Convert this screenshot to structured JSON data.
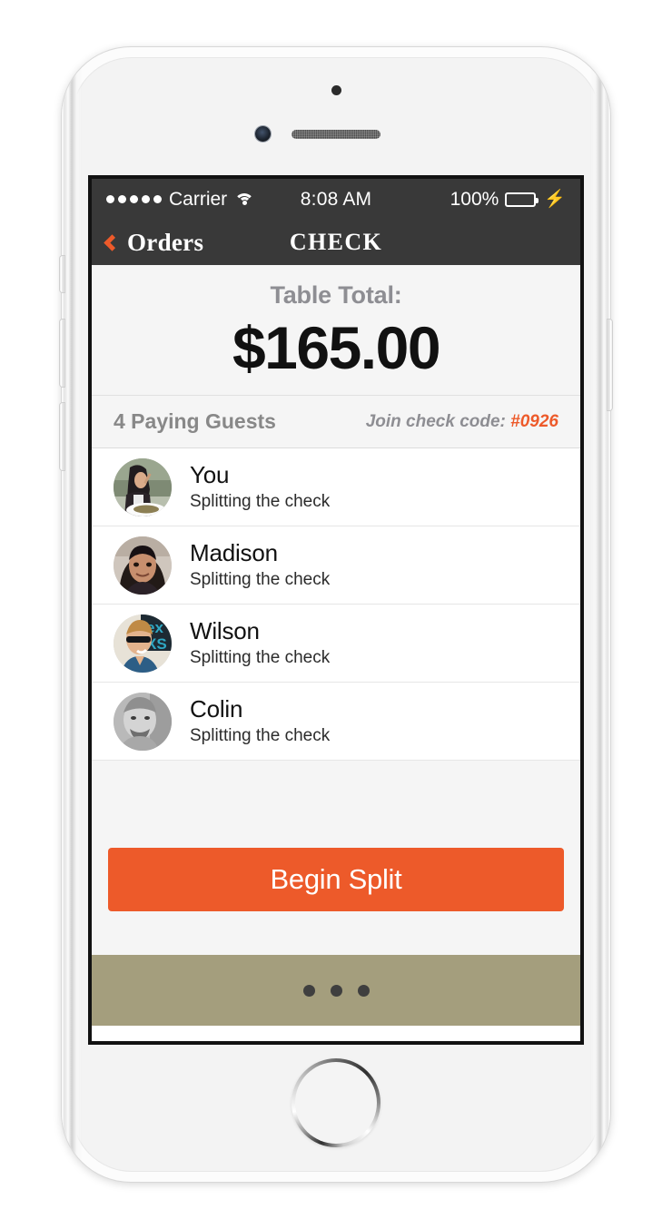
{
  "status_bar": {
    "signal_dots": 5,
    "carrier": "Carrier",
    "wifi_icon": "wifi-icon",
    "time": "8:08 AM",
    "battery_percent": "100%",
    "charging_icon": "⚡"
  },
  "nav_bar": {
    "back_icon": "chevron-left-icon",
    "back_label": "Orders",
    "title": "CHECK",
    "background_color": "#393939",
    "accent_color": "#ED5A2A"
  },
  "total": {
    "label": "Table Total:",
    "amount": "$165.00"
  },
  "guests_header": {
    "count_label": "4 Paying Guests",
    "join_label": "Join check code:",
    "join_code": "#0926"
  },
  "guests": [
    {
      "name": "You",
      "status": "Splitting the check",
      "avatar": "avatar-you"
    },
    {
      "name": "Madison",
      "status": "Splitting the check",
      "avatar": "avatar-madison"
    },
    {
      "name": "Wilson",
      "status": "Splitting the check",
      "avatar": "avatar-wilson"
    },
    {
      "name": "Colin",
      "status": "Splitting the check",
      "avatar": "avatar-colin"
    }
  ],
  "cta": {
    "label": "Begin Split",
    "color": "#ED5A2A"
  },
  "bottom_bar": {
    "dots": 3,
    "color": "#A49E7D"
  }
}
